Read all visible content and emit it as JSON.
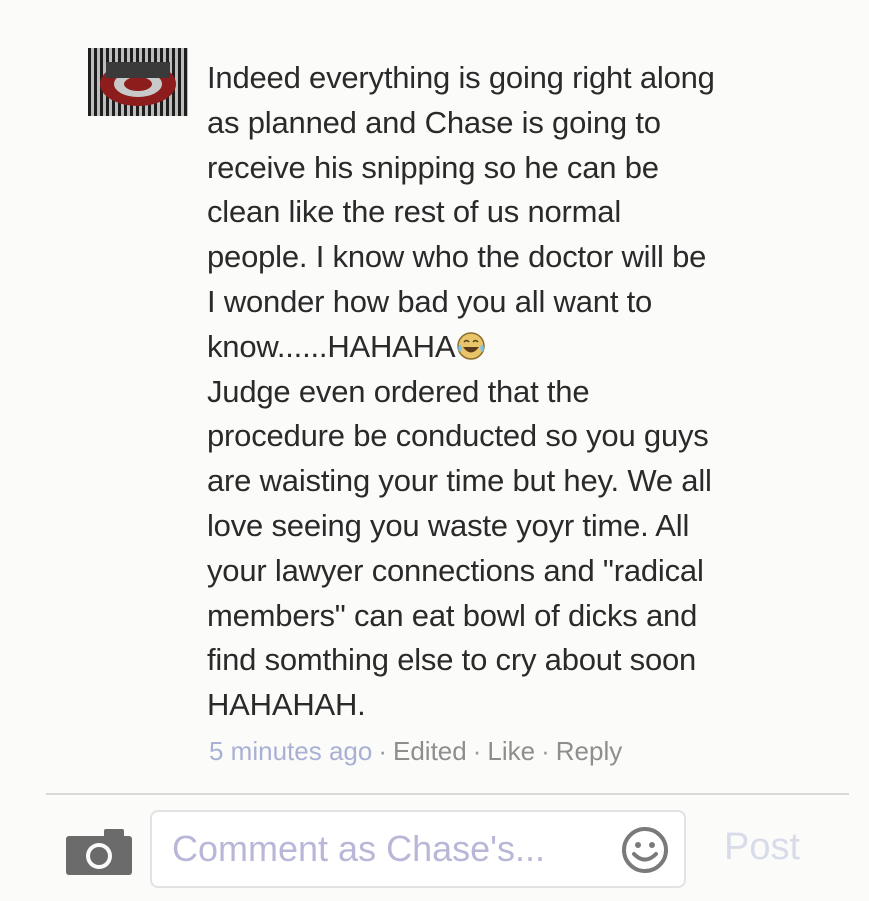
{
  "comment": {
    "avatar_icon": "ohio-state-logo-avatar",
    "paragraph_1": "Indeed everything is going right along\nas planned and Chase is going to\nreceive his snipping so he can be\nclean like the rest of us normal\npeople. I know who the doctor will be\nI wonder how bad you all want to\nknow......HAHAHA",
    "emoji": "tears-of-joy-emoji",
    "paragraph_2": "Judge even ordered that the\nprocedure be conducted so you guys\nare waisting your time but hey. We all\nlove seeing you waste yoyr time. All\nyour lawyer connections and \"radical\nmembers\" can eat bowl of dicks  and\nfind somthing else to cry about soon\nHAHAHAH."
  },
  "meta": {
    "time": "5 minutes ago",
    "separator": "·",
    "edited": "Edited",
    "like": "Like",
    "reply": "Reply",
    "time_color": "#a9b0d4"
  },
  "composer": {
    "camera_icon": "camera-icon",
    "placeholder": "Comment as Chase's...",
    "smiley_icon": "smiley-icon",
    "post_label": "Post",
    "post_color": "#d8dce9"
  }
}
